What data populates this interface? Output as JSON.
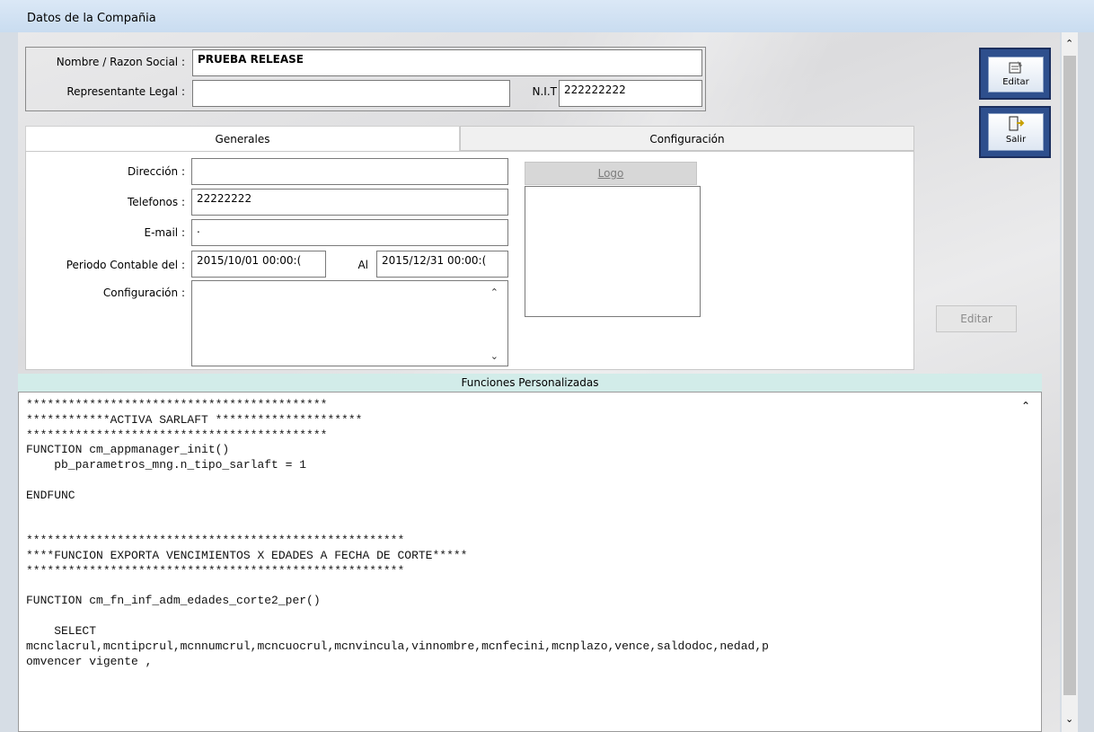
{
  "window": {
    "title": "Datos de la Compañia"
  },
  "company": {
    "nombre_label": "Nombre / Razon Social :",
    "nombre_value": "PRUEBA RELEASE",
    "representante_label": "Representante Legal :",
    "representante_value": "",
    "nit_label": "N.I.T",
    "nit_value": "222222222"
  },
  "tabs": [
    {
      "label": "Generales",
      "active": true
    },
    {
      "label": "Configuración",
      "active": false
    }
  ],
  "generales": {
    "direccion_label": "Dirección :",
    "direccion_value": "",
    "telefonos_label": "Telefonos :",
    "telefonos_value": "22222222",
    "email_label": "E-mail :",
    "email_value": ".",
    "periodo_label": "Periodo Contable del :",
    "periodo_desde": "2015/10/01 00:00:(",
    "periodo_al_label": "Al",
    "periodo_hasta": "2015/12/31 00:00:(",
    "configuracion_label": "Configuración :",
    "configuracion_value": "",
    "logo_button": "Logo"
  },
  "funciones": {
    "header": "Funciones Personalizadas",
    "code": "*******************************************\n************ACTIVA SARLAFT *********************\n*******************************************\nFUNCTION cm_appmanager_init()\n    pb_parametros_mng.n_tipo_sarlaft = 1\n\nENDFUNC\n\n\n******************************************************\n****FUNCION EXPORTA VENCIMIENTOS X EDADES A FECHA DE CORTE*****\n******************************************************\n\nFUNCTION cm_fn_inf_adm_edades_corte2_per()\n\n    SELECT\nmcnclacrul,mcntipcrul,mcnnumcrul,mcncuocrul,mcnvincula,vinnombre,mcnfecini,mcnplazo,vence,saldodoc,nedad,p\nomvencer vigente ,"
  },
  "toolbar": {
    "editar_label": "Editar",
    "salir_label": "Salir",
    "editar2_label": "Editar"
  }
}
